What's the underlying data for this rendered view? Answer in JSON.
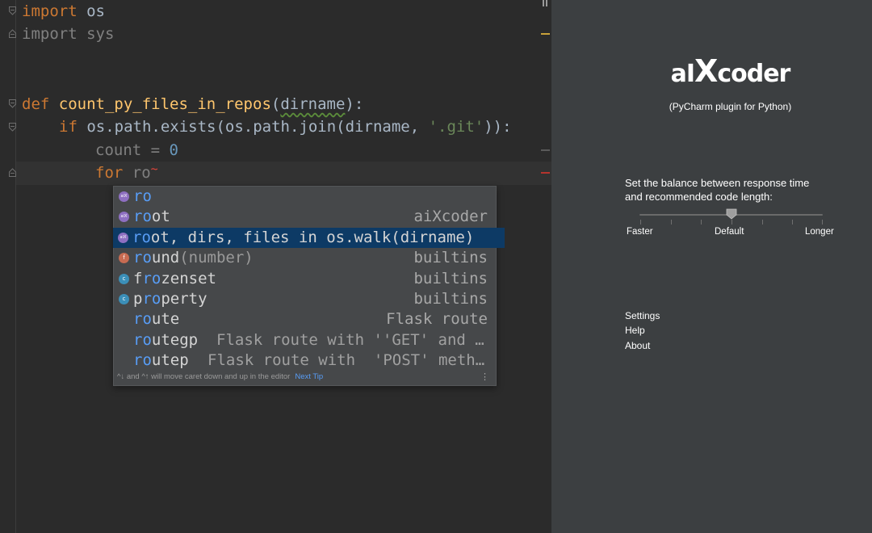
{
  "editor": {
    "lines": {
      "l1_kw": "import",
      "l1_mod": " os",
      "l2_kw": "import",
      "l2_mod": " sys",
      "l5_kw": "def",
      "l5_fn": "count_py_files_in_repos",
      "l5_open": "(",
      "l5_param": "dirname",
      "l5_close": "):",
      "l6_kw": "if",
      "l6_code": " os.path.exists(os.path.join(dirname, ",
      "l6_str": "'.git'",
      "l6_end": ")):",
      "l7_var": "count",
      "l7_eq": " = ",
      "l7_num": "0",
      "l8_kw": "for",
      "l8_typed": " ro",
      "l8_err": "~"
    }
  },
  "completion": {
    "items": [
      {
        "icon": "aiX",
        "match": "ro",
        "rest": "",
        "desc": "",
        "type": ""
      },
      {
        "icon": "aiX",
        "match": "ro",
        "rest": "ot",
        "desc": "",
        "type": "aiXcoder"
      },
      {
        "icon": "aiX",
        "match": "ro",
        "rest": "ot, dirs, files in os.walk(dirname)",
        "desc": "",
        "type": ""
      },
      {
        "icon": "f",
        "match": "ro",
        "rest": "und",
        "desc": "(number)",
        "type": "builtins"
      },
      {
        "icon": "c",
        "pre": "f",
        "match": "ro",
        "rest": "zenset",
        "desc": "",
        "type": "builtins"
      },
      {
        "icon": "c",
        "pre": "p",
        "match": "ro",
        "rest": "perty",
        "desc": "",
        "type": "builtins"
      },
      {
        "icon": "",
        "match": "ro",
        "rest": "ute",
        "desc": "",
        "type": "Flask route"
      },
      {
        "icon": "",
        "match": "ro",
        "rest": "utegp",
        "desc": "Flask route with ''GET' and …",
        "type": ""
      },
      {
        "icon": "",
        "match": "ro",
        "rest": "utep",
        "desc": "Flask route with  'POST' meth…",
        "type": ""
      }
    ],
    "footer_hint": "^↓ and ^↑ will move caret down and up in the editor",
    "next_tip": "Next Tip",
    "menu_glyph": "⋮"
  },
  "panel": {
    "logo_a": "aI",
    "logo_x": "X",
    "logo_rest": "coder",
    "subtitle": "(PyCharm plugin for Python)",
    "balance_line1": "Set the balance between response time",
    "balance_line2": "and recommended code length:",
    "slider": {
      "labels": [
        "Faster",
        "Default",
        "Longer"
      ],
      "value": "Default"
    },
    "links": [
      "Settings",
      "Help",
      "About"
    ]
  },
  "colors": {
    "editor_bg": "#2b2b2b",
    "panel_bg": "#3c3f41",
    "keyword": "#cc7832",
    "function": "#ffc66d",
    "string": "#6a8759",
    "number": "#6897bb",
    "match": "#589df6",
    "selection": "#0d3a65"
  }
}
